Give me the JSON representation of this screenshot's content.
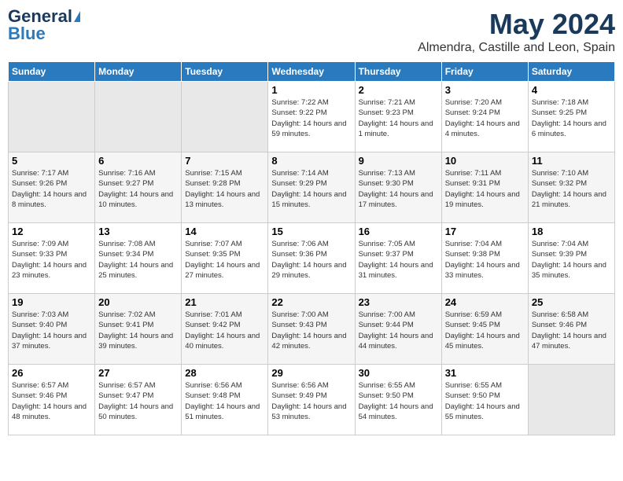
{
  "header": {
    "logo_general": "General",
    "logo_blue": "Blue",
    "title": "May 2024",
    "subtitle": "Almendra, Castille and Leon, Spain"
  },
  "weekdays": [
    "Sunday",
    "Monday",
    "Tuesday",
    "Wednesday",
    "Thursday",
    "Friday",
    "Saturday"
  ],
  "weeks": [
    [
      {
        "day": "",
        "empty": true
      },
      {
        "day": "",
        "empty": true
      },
      {
        "day": "",
        "empty": true
      },
      {
        "day": "1",
        "sunrise": "Sunrise: 7:22 AM",
        "sunset": "Sunset: 9:22 PM",
        "daylight": "Daylight: 14 hours and 59 minutes."
      },
      {
        "day": "2",
        "sunrise": "Sunrise: 7:21 AM",
        "sunset": "Sunset: 9:23 PM",
        "daylight": "Daylight: 14 hours and 1 minute."
      },
      {
        "day": "3",
        "sunrise": "Sunrise: 7:20 AM",
        "sunset": "Sunset: 9:24 PM",
        "daylight": "Daylight: 14 hours and 4 minutes."
      },
      {
        "day": "4",
        "sunrise": "Sunrise: 7:18 AM",
        "sunset": "Sunset: 9:25 PM",
        "daylight": "Daylight: 14 hours and 6 minutes."
      }
    ],
    [
      {
        "day": "5",
        "sunrise": "Sunrise: 7:17 AM",
        "sunset": "Sunset: 9:26 PM",
        "daylight": "Daylight: 14 hours and 8 minutes."
      },
      {
        "day": "6",
        "sunrise": "Sunrise: 7:16 AM",
        "sunset": "Sunset: 9:27 PM",
        "daylight": "Daylight: 14 hours and 10 minutes."
      },
      {
        "day": "7",
        "sunrise": "Sunrise: 7:15 AM",
        "sunset": "Sunset: 9:28 PM",
        "daylight": "Daylight: 14 hours and 13 minutes."
      },
      {
        "day": "8",
        "sunrise": "Sunrise: 7:14 AM",
        "sunset": "Sunset: 9:29 PM",
        "daylight": "Daylight: 14 hours and 15 minutes."
      },
      {
        "day": "9",
        "sunrise": "Sunrise: 7:13 AM",
        "sunset": "Sunset: 9:30 PM",
        "daylight": "Daylight: 14 hours and 17 minutes."
      },
      {
        "day": "10",
        "sunrise": "Sunrise: 7:11 AM",
        "sunset": "Sunset: 9:31 PM",
        "daylight": "Daylight: 14 hours and 19 minutes."
      },
      {
        "day": "11",
        "sunrise": "Sunrise: 7:10 AM",
        "sunset": "Sunset: 9:32 PM",
        "daylight": "Daylight: 14 hours and 21 minutes."
      }
    ],
    [
      {
        "day": "12",
        "sunrise": "Sunrise: 7:09 AM",
        "sunset": "Sunset: 9:33 PM",
        "daylight": "Daylight: 14 hours and 23 minutes."
      },
      {
        "day": "13",
        "sunrise": "Sunrise: 7:08 AM",
        "sunset": "Sunset: 9:34 PM",
        "daylight": "Daylight: 14 hours and 25 minutes."
      },
      {
        "day": "14",
        "sunrise": "Sunrise: 7:07 AM",
        "sunset": "Sunset: 9:35 PM",
        "daylight": "Daylight: 14 hours and 27 minutes."
      },
      {
        "day": "15",
        "sunrise": "Sunrise: 7:06 AM",
        "sunset": "Sunset: 9:36 PM",
        "daylight": "Daylight: 14 hours and 29 minutes."
      },
      {
        "day": "16",
        "sunrise": "Sunrise: 7:05 AM",
        "sunset": "Sunset: 9:37 PM",
        "daylight": "Daylight: 14 hours and 31 minutes."
      },
      {
        "day": "17",
        "sunrise": "Sunrise: 7:04 AM",
        "sunset": "Sunset: 9:38 PM",
        "daylight": "Daylight: 14 hours and 33 minutes."
      },
      {
        "day": "18",
        "sunrise": "Sunrise: 7:04 AM",
        "sunset": "Sunset: 9:39 PM",
        "daylight": "Daylight: 14 hours and 35 minutes."
      }
    ],
    [
      {
        "day": "19",
        "sunrise": "Sunrise: 7:03 AM",
        "sunset": "Sunset: 9:40 PM",
        "daylight": "Daylight: 14 hours and 37 minutes."
      },
      {
        "day": "20",
        "sunrise": "Sunrise: 7:02 AM",
        "sunset": "Sunset: 9:41 PM",
        "daylight": "Daylight: 14 hours and 39 minutes."
      },
      {
        "day": "21",
        "sunrise": "Sunrise: 7:01 AM",
        "sunset": "Sunset: 9:42 PM",
        "daylight": "Daylight: 14 hours and 40 minutes."
      },
      {
        "day": "22",
        "sunrise": "Sunrise: 7:00 AM",
        "sunset": "Sunset: 9:43 PM",
        "daylight": "Daylight: 14 hours and 42 minutes."
      },
      {
        "day": "23",
        "sunrise": "Sunrise: 7:00 AM",
        "sunset": "Sunset: 9:44 PM",
        "daylight": "Daylight: 14 hours and 44 minutes."
      },
      {
        "day": "24",
        "sunrise": "Sunrise: 6:59 AM",
        "sunset": "Sunset: 9:45 PM",
        "daylight": "Daylight: 14 hours and 45 minutes."
      },
      {
        "day": "25",
        "sunrise": "Sunrise: 6:58 AM",
        "sunset": "Sunset: 9:46 PM",
        "daylight": "Daylight: 14 hours and 47 minutes."
      }
    ],
    [
      {
        "day": "26",
        "sunrise": "Sunrise: 6:57 AM",
        "sunset": "Sunset: 9:46 PM",
        "daylight": "Daylight: 14 hours and 48 minutes."
      },
      {
        "day": "27",
        "sunrise": "Sunrise: 6:57 AM",
        "sunset": "Sunset: 9:47 PM",
        "daylight": "Daylight: 14 hours and 50 minutes."
      },
      {
        "day": "28",
        "sunrise": "Sunrise: 6:56 AM",
        "sunset": "Sunset: 9:48 PM",
        "daylight": "Daylight: 14 hours and 51 minutes."
      },
      {
        "day": "29",
        "sunrise": "Sunrise: 6:56 AM",
        "sunset": "Sunset: 9:49 PM",
        "daylight": "Daylight: 14 hours and 53 minutes."
      },
      {
        "day": "30",
        "sunrise": "Sunrise: 6:55 AM",
        "sunset": "Sunset: 9:50 PM",
        "daylight": "Daylight: 14 hours and 54 minutes."
      },
      {
        "day": "31",
        "sunrise": "Sunrise: 6:55 AM",
        "sunset": "Sunset: 9:50 PM",
        "daylight": "Daylight: 14 hours and 55 minutes."
      },
      {
        "day": "",
        "empty": true
      }
    ]
  ]
}
